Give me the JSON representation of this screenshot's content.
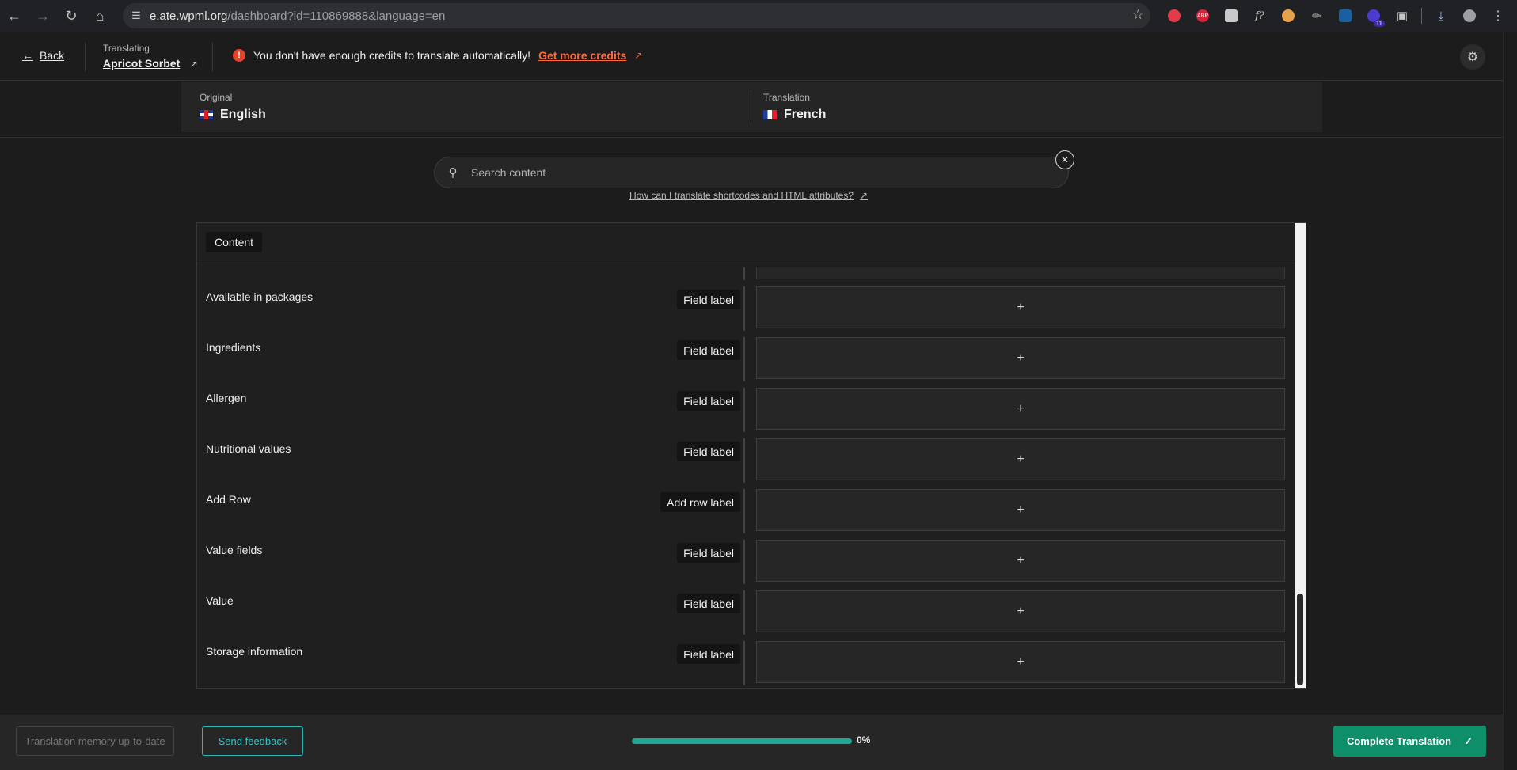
{
  "browser": {
    "url_host": "e.ate.wpml.org",
    "url_path": "/dashboard?id=110869888&language=en",
    "extension_badge": "11",
    "extensions": [
      "abp-icon",
      "font-icon",
      "puzzle-icon"
    ]
  },
  "header": {
    "back_label": "Back",
    "translating_label": "Translating",
    "doc_title": "Apricot Sorbet",
    "alert_text": "You don't have enough credits to translate automatically!",
    "alert_link": "Get more credits"
  },
  "languages": {
    "original_caption": "Original",
    "original_name": "English",
    "translation_caption": "Translation",
    "translation_name": "French"
  },
  "search": {
    "placeholder": "Search content",
    "help_link": "How can I translate shortcodes and HTML attributes?"
  },
  "content": {
    "tab_label": "Content",
    "rows": [
      {
        "original": "Available in packages",
        "type": "Field label"
      },
      {
        "original": "Ingredients",
        "type": "Field label"
      },
      {
        "original": "Allergen",
        "type": "Field label"
      },
      {
        "original": "Nutritional values",
        "type": "Field label"
      },
      {
        "original": "Add Row",
        "type": "Add row label"
      },
      {
        "original": "Value fields",
        "type": "Field label"
      },
      {
        "original": "Value",
        "type": "Field label"
      },
      {
        "original": "Storage information",
        "type": "Field label"
      }
    ]
  },
  "footer": {
    "tm_label": "Translation memory up-to-date",
    "feedback_label": "Send feedback",
    "progress_percent": 0,
    "progress_text": "0%",
    "complete_label": "Complete Translation"
  },
  "colors": {
    "accent_teal": "#21a894",
    "complete_green": "#0e8f6a",
    "alert_red": "#e2452b",
    "credits_link": "#ff6a3d"
  }
}
